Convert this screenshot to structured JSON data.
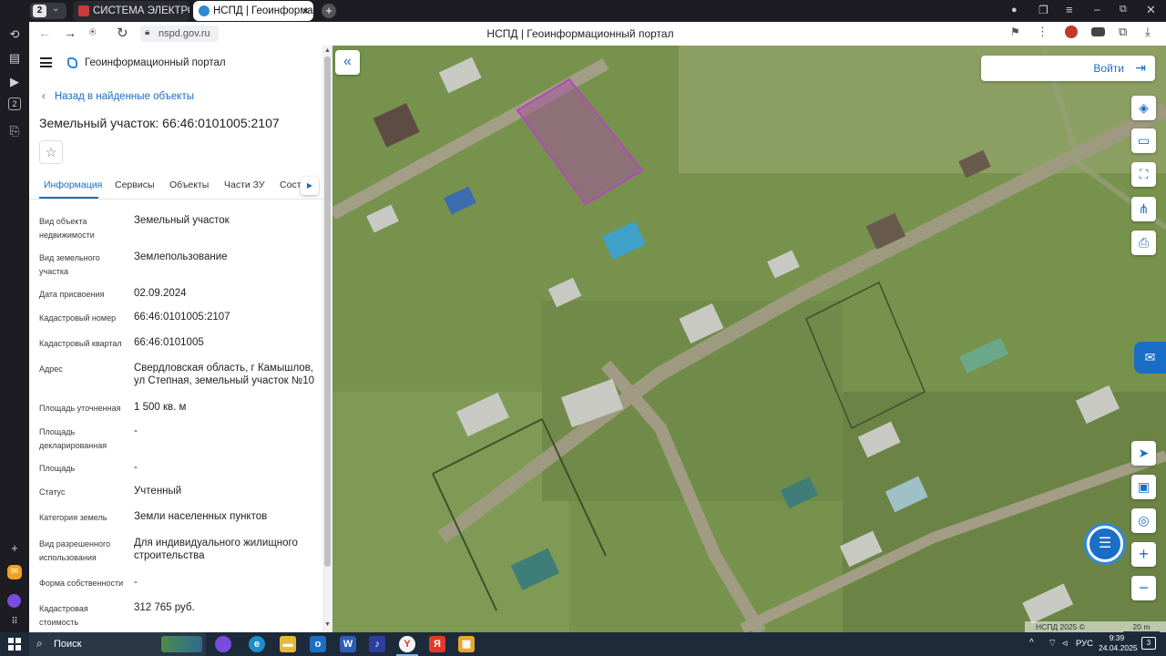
{
  "browser": {
    "tab_count": "2",
    "tabs": [
      {
        "label": "СИСТЕМА ЭЛЕКТРОННО",
        "active": false
      },
      {
        "label": "НСПД | Геоинформаци",
        "active": true
      }
    ],
    "url": "nspd.gov.ru",
    "page_title": "НСПД | Геоинформационный портал"
  },
  "panel": {
    "portal_title": "Геоинформационный портал",
    "back_link": "Назад в найденные объекты",
    "heading": "Земельный участок: 66:46:0101005:2107",
    "tabs": [
      "Информация",
      "Сервисы",
      "Объекты",
      "Части ЗУ",
      "Состав"
    ],
    "properties": [
      {
        "label": "Вид объекта недвижимости",
        "value": "Земельный участок"
      },
      {
        "label": "Вид земельного участка",
        "value": "Землепользование"
      },
      {
        "label": "Дата присвоения",
        "value": "02.09.2024"
      },
      {
        "label": "Кадастровый номер",
        "value": "66:46:0101005:2107"
      },
      {
        "label": "Кадастровый квартал",
        "value": "66:46:0101005"
      },
      {
        "label": "Адрес",
        "value": "Свердловская область, г Камышлов, ул Степная, земельный участок №10"
      },
      {
        "label": "Площадь уточненная",
        "value": "1 500 кв. м"
      },
      {
        "label": "Площадь декларированная",
        "value": "-"
      },
      {
        "label": "Площадь",
        "value": "-"
      },
      {
        "label": "Статус",
        "value": "Учтенный"
      },
      {
        "label": "Категория земель",
        "value": "Земли населенных пунктов"
      },
      {
        "label": "Вид разрешенного использования",
        "value": "Для индивидуального жилищного строительства"
      },
      {
        "label": "Форма собственности",
        "value": "-"
      },
      {
        "label": "Кадастровая стоимость",
        "value": "312 765 руб."
      }
    ]
  },
  "map": {
    "login_label": "Войти",
    "attribution": "НСПД 2025 ©",
    "scale_label": "20 m",
    "parcel_color": "#b04ab8"
  },
  "taskbar": {
    "search_label": "Поиск",
    "lang": "РУС",
    "time": "9:39",
    "date": "24.04.2025",
    "notifications": "3"
  }
}
